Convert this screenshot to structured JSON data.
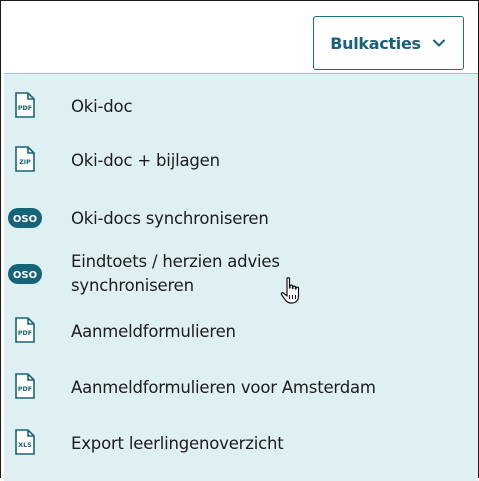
{
  "bulk_actions": {
    "label": "Bulkacties",
    "chevron_icon": "chevron-down-icon"
  },
  "menu": {
    "items": [
      {
        "label": "Oki-doc",
        "icon": "pdf-file-icon",
        "badge": "PDF"
      },
      {
        "label": "Oki-doc + bijlagen",
        "icon": "zip-file-icon",
        "badge": "ZIP"
      },
      {
        "label": "Oki-docs synchroniseren",
        "icon": "oso-icon",
        "badge": "OSO"
      },
      {
        "label_line1": "Eindtoets / herzien advies",
        "label_line2": "synchroniseren",
        "icon": "oso-icon",
        "badge": "OSO"
      },
      {
        "label": "Aanmeldformulieren",
        "icon": "pdf-file-icon",
        "badge": "PDF"
      },
      {
        "label": "Aanmeldformulieren voor Amsterdam",
        "icon": "pdf-file-icon",
        "badge": "PDF"
      },
      {
        "label": "Export leerlingenoverzicht",
        "icon": "xls-file-icon",
        "badge": "XLS"
      }
    ]
  },
  "colors": {
    "accent": "#17647a",
    "menu_background": "#dff0f3",
    "text": "#1c1c1c"
  }
}
